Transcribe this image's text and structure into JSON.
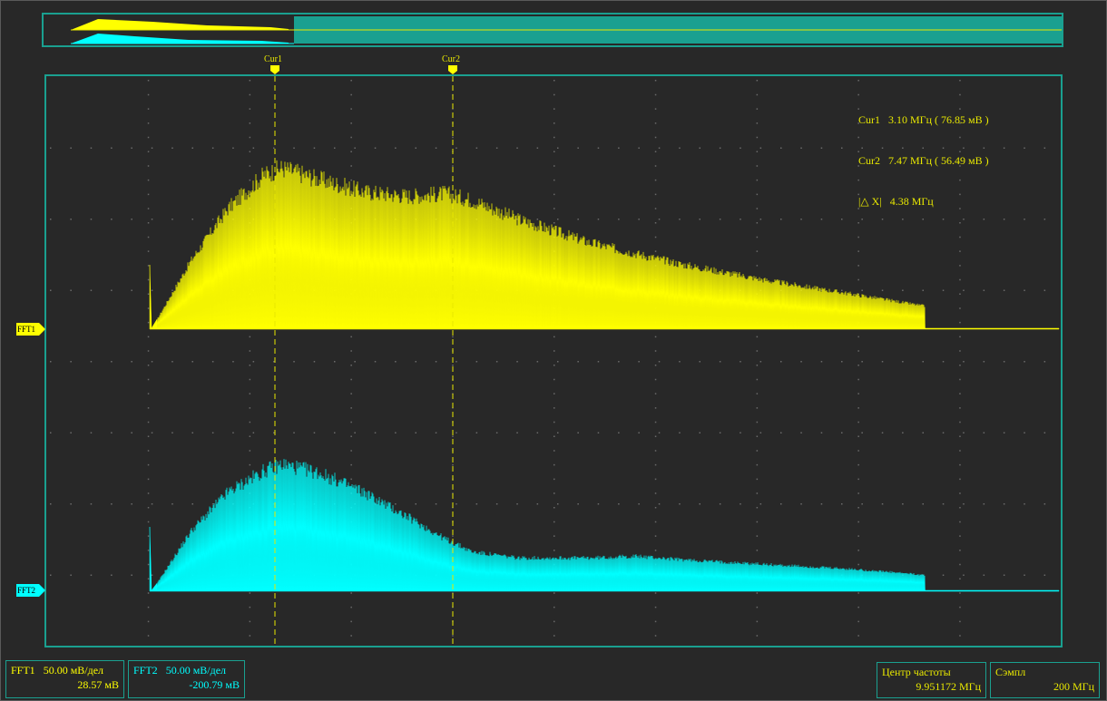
{
  "colors": {
    "fft1": "#ffff00",
    "fft2": "#00ffff",
    "frame": "#1aa090",
    "background": "#282828",
    "cursor": "#e8e800"
  },
  "cursors": {
    "cur1_label": "Cur1",
    "cur2_label": "Cur2",
    "readout": {
      "cur1": "Cur1   3.10 МГц ( 76.85 мВ )",
      "cur2": "Cur2   7.47 МГц ( 56.49 мВ )",
      "delta": "|△ X|   4.38 МГц"
    }
  },
  "channels": {
    "fft1": {
      "marker": "FFT1",
      "name": "FFT1",
      "scale": "50.00 мВ/дел",
      "offset": "28.57 мВ"
    },
    "fft2": {
      "marker": "FFT2",
      "name": "FFT2",
      "scale": "50.00 мВ/дел",
      "offset": "-200.79 мВ"
    }
  },
  "center_freq": {
    "label": "Центр частоты",
    "value": "9.951172 МГц"
  },
  "sample": {
    "label": "Сэмпл",
    "value": "200 МГц"
  }
}
